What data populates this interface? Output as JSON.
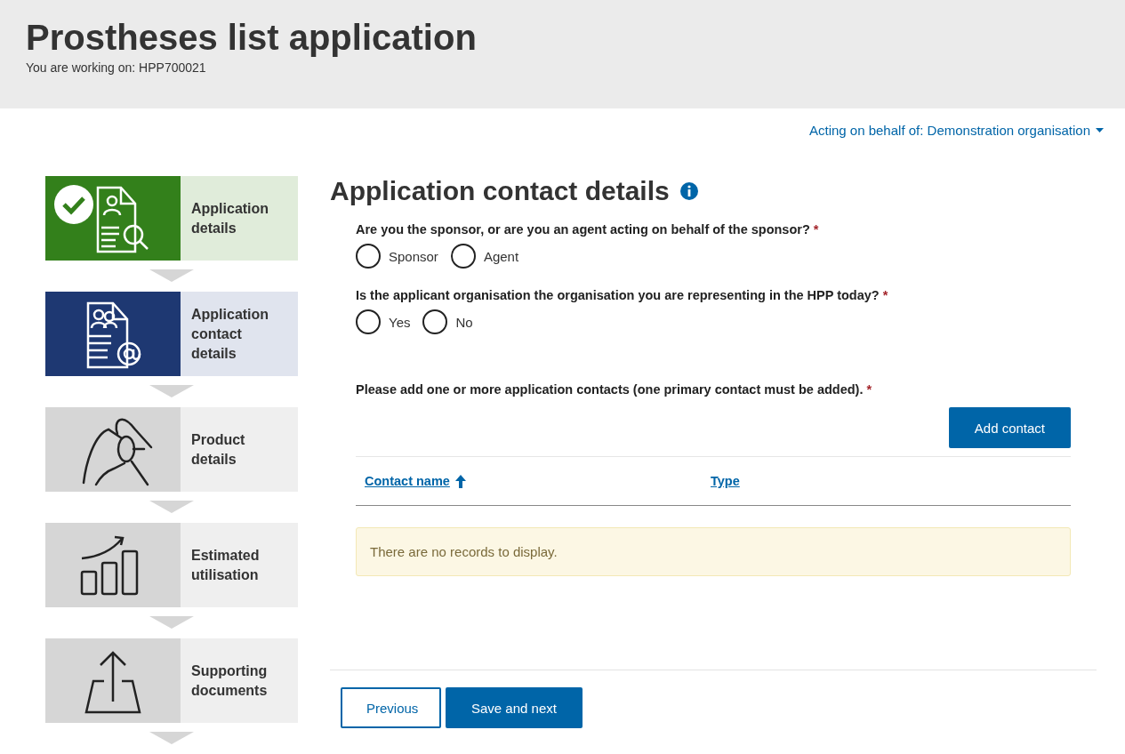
{
  "header": {
    "title": "Prostheses list application",
    "subtitle": "You are working on: HPP700021"
  },
  "acting_menu": {
    "label": "Acting on behalf of: Demonstration organisation"
  },
  "steps": [
    {
      "label": "Application details",
      "completed": true,
      "selected": false
    },
    {
      "label": "Application contact details",
      "completed": false,
      "selected": true
    },
    {
      "label": "Product details",
      "completed": false,
      "selected": false
    },
    {
      "label": "Estimated utilisation",
      "completed": false,
      "selected": false
    },
    {
      "label": "Supporting documents",
      "completed": false,
      "selected": false
    }
  ],
  "section": {
    "title": "Application contact details"
  },
  "questions": [
    {
      "label": "Are you the sponsor, or are you an agent acting on behalf of the sponsor?",
      "required_mark": "*",
      "options": [
        {
          "label": "Sponsor",
          "selected": false
        },
        {
          "label": "Agent",
          "selected": false
        }
      ]
    },
    {
      "label": "Is the applicant organisation the organisation you are representing in the HPP today?",
      "required_mark": "*",
      "options": [
        {
          "label": "Yes",
          "selected": false
        },
        {
          "label": "No",
          "selected": false
        }
      ]
    }
  ],
  "contacts": {
    "label": "Please add one or more application contacts (one primary contact must be added).",
    "required_mark": "*",
    "add_button": "Add contact",
    "columns": [
      {
        "label": "Contact name",
        "sorted": true
      },
      {
        "label": "Type",
        "sorted": false
      }
    ],
    "empty_message": "There are no records to display."
  },
  "buttons": [
    {
      "label": "Previous",
      "kind": "secondary"
    },
    {
      "label": "Save and next",
      "kind": "primary"
    }
  ]
}
